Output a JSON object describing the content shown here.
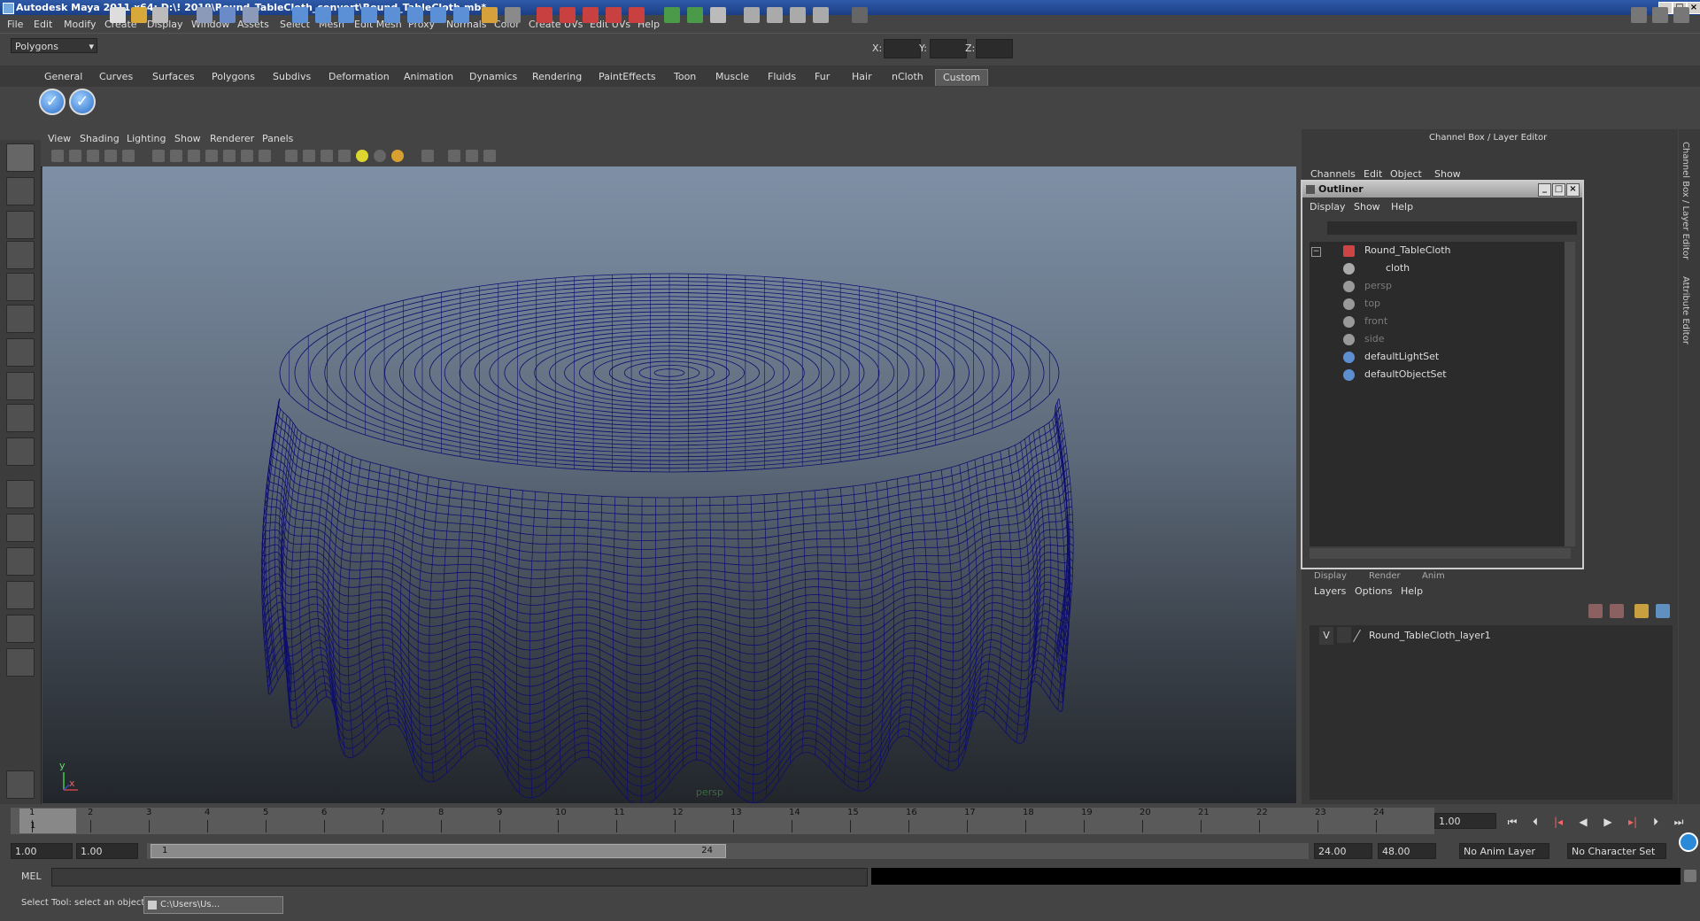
{
  "window": {
    "title": "Autodesk Maya 2011 x64: D:\\! 2019\\Round_TableCloth_convert\\Round_TableCloth.mb*"
  },
  "menubar": [
    "File",
    "Edit",
    "Modify",
    "Create",
    "Display",
    "Window",
    "Assets",
    "Select",
    "Mesh",
    "Edit Mesh",
    "Proxy",
    "Normals",
    "Color",
    "Create UVs",
    "Edit UVs",
    "Help"
  ],
  "status": {
    "menu_set": "Polygons",
    "x_label": "X:",
    "y_label": "Y:",
    "z_label": "Z:"
  },
  "shelf_tabs": [
    "General",
    "Curves",
    "Surfaces",
    "Polygons",
    "Subdivs",
    "Deformation",
    "Animation",
    "Dynamics",
    "Rendering",
    "PaintEffects",
    "Toon",
    "Muscle",
    "Fluids",
    "Fur",
    "Hair",
    "nCloth",
    "Custom"
  ],
  "shelf_active": "Custom",
  "viewport": {
    "menus": [
      "View",
      "Shading",
      "Lighting",
      "Show",
      "Renderer",
      "Panels"
    ],
    "camera": "persp",
    "axis_x": "x",
    "axis_y": "y"
  },
  "channel_box": {
    "title": "Channel Box / Layer Editor",
    "menus": [
      "Channels",
      "Edit",
      "Object",
      "Show"
    ]
  },
  "outliner": {
    "title": "Outliner",
    "menus": [
      "Display",
      "Show",
      "Help"
    ],
    "items": [
      {
        "label": "Round_TableCloth",
        "dim": false
      },
      {
        "label": "cloth",
        "dim": false
      },
      {
        "label": "persp",
        "dim": true
      },
      {
        "label": "top",
        "dim": true
      },
      {
        "label": "front",
        "dim": true
      },
      {
        "label": "side",
        "dim": true
      },
      {
        "label": "defaultLightSet",
        "dim": false
      },
      {
        "label": "defaultObjectSet",
        "dim": false
      }
    ]
  },
  "layer_editor": {
    "tabs": [
      "Display",
      "Render",
      "Anim"
    ],
    "menus": [
      "Layers",
      "Options",
      "Help"
    ],
    "layer": {
      "visible": "V",
      "name": "Round_TableCloth_layer1"
    }
  },
  "side_tabs": [
    "Channel Box / Layer Editor",
    "Attribute Editor"
  ],
  "timeline": {
    "ticks": [
      "1",
      "2",
      "3",
      "4",
      "5",
      "6",
      "7",
      "8",
      "9",
      "10",
      "11",
      "12",
      "13",
      "14",
      "15",
      "16",
      "17",
      "18",
      "19",
      "20",
      "21",
      "22",
      "23",
      "24"
    ],
    "current_frame": "1",
    "current_time": "1.00"
  },
  "range": {
    "start": "1.00",
    "playback_start": "1.00",
    "handle_start": "1",
    "handle_end": "24",
    "playback_end": "24.00",
    "end": "48.00",
    "anim_layer": "No Anim Layer",
    "character_set": "No Character Set"
  },
  "command": {
    "label": "MEL"
  },
  "helpline": {
    "text": "Select Tool: select an object",
    "task": "C:\\Users\\Us..."
  },
  "colors": {
    "wire": "#0d0d6e",
    "viewport_top": "#7f90a6",
    "viewport_bottom": "#22262b"
  }
}
